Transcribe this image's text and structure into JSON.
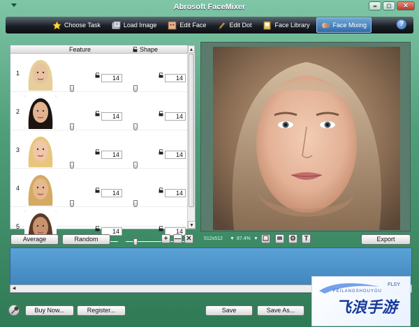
{
  "window": {
    "title": "Abrosoft FaceMixer",
    "buttons": [
      "–",
      "□",
      "✕"
    ]
  },
  "toolbar": {
    "items": [
      {
        "label": "Choose Task",
        "icon": "star-icon",
        "active": false
      },
      {
        "label": "Load Image",
        "icon": "load-image-icon",
        "active": false
      },
      {
        "label": "Edit Face",
        "icon": "edit-face-icon",
        "active": false
      },
      {
        "label": "Edit Dot",
        "icon": "edit-dot-icon",
        "active": false
      },
      {
        "label": "Face Library",
        "icon": "face-library-icon",
        "active": false
      },
      {
        "label": "Face Mixing",
        "icon": "face-mixing-icon",
        "active": true
      }
    ],
    "help": "?"
  },
  "faces": {
    "headers": {
      "feature": "Feature",
      "shape": "Shape"
    },
    "rows": [
      {
        "num": "1",
        "feature": "14",
        "shape": "14"
      },
      {
        "num": "2",
        "feature": "14",
        "shape": "14"
      },
      {
        "num": "3",
        "feature": "14",
        "shape": "14"
      },
      {
        "num": "4",
        "feature": "14",
        "shape": "14"
      },
      {
        "num": "5",
        "feature": "14",
        "shape": "14"
      }
    ]
  },
  "actions": {
    "average": "Average",
    "random": "Random",
    "add": "+",
    "remove": "—",
    "clear": "✕",
    "export": "Export"
  },
  "image_info": {
    "size": "512x512",
    "zoom": "87.4%"
  },
  "bottom": {
    "buy": "Buy Now...",
    "register": "Register...",
    "save": "Save",
    "save_as": "Save As..."
  },
  "watermark": {
    "main": "飞浪手游",
    "sub": "FEILANGSHOUYOU",
    "top": "FLSY"
  },
  "colors": {
    "accent": "#2f6aa8",
    "toolbar": "#1b1f26",
    "list": "#4a90c8"
  }
}
